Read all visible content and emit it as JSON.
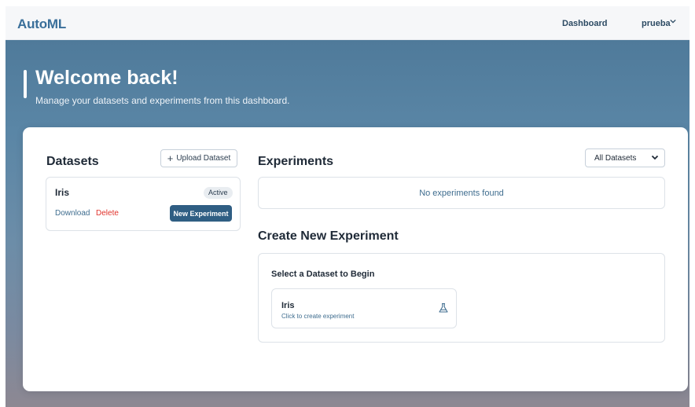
{
  "nav": {
    "brand": "AutoML",
    "dashboard_link": "Dashboard",
    "user": "prueba",
    "user_menu_icon": "chevron-down-icon"
  },
  "hero": {
    "title": "Welcome back!",
    "subtitle": "Manage your datasets and experiments from this dashboard."
  },
  "datasets": {
    "title": "Datasets",
    "upload_label": "Upload Dataset",
    "upload_icon": "plus-icon",
    "items": [
      {
        "name": "Iris",
        "status": "Active",
        "download_label": "Download",
        "delete_label": "Delete",
        "new_experiment_label": "New Experiment"
      }
    ]
  },
  "experiments": {
    "title": "Experiments",
    "filter_selected": "All Datasets",
    "empty_message": "No experiments found"
  },
  "create_experiment": {
    "title": "Create New Experiment",
    "heading": "Select a Dataset to Begin",
    "datasets": [
      {
        "name": "Iris",
        "hint": "Click to create experiment",
        "icon": "flask-icon"
      }
    ]
  },
  "colors": {
    "brand": "#3a6f9a",
    "primary_button": "#2f5e83",
    "danger": "#e0322b",
    "link": "#3f6d8f"
  }
}
